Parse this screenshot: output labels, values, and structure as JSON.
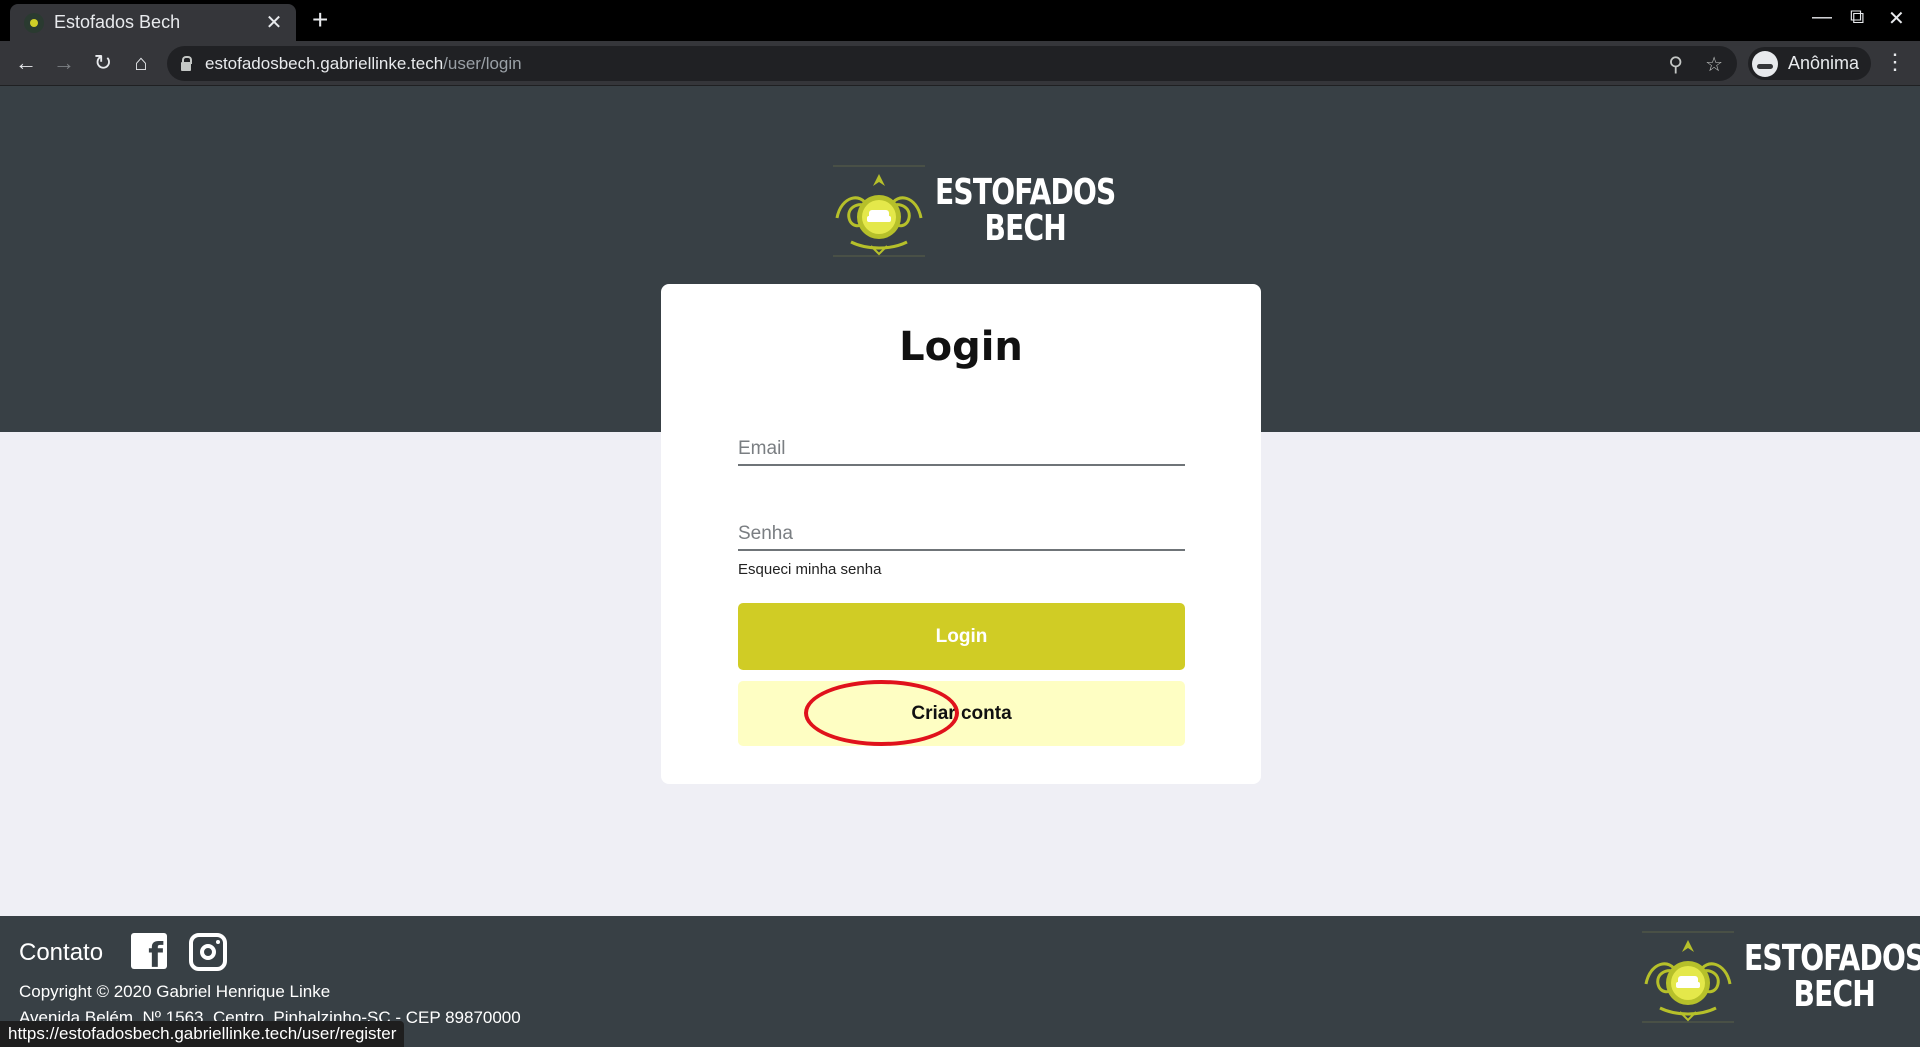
{
  "browser": {
    "tab_title": "Estofados Bech",
    "tab_close": "✕",
    "new_tab": "+",
    "url_host": "estofadosbech.gabriellinke.tech",
    "url_path": "/user/login",
    "profile_label": "Anônima",
    "status_url": "https://estofadosbech.gabriellinke.tech/user/register"
  },
  "brand": {
    "line1": "ESTOFADOS",
    "line2": "BECH",
    "accent_color": "#d0cc25"
  },
  "login": {
    "title": "Login",
    "email_placeholder": "Email",
    "password_placeholder": "Senha",
    "forgot_label": "Esqueci minha senha",
    "submit_label": "Login",
    "register_label": "Criar conta"
  },
  "footer": {
    "contact_label": "Contato",
    "copyright": "Copyright © 2020 Gabriel Henrique Linke",
    "address": "Avenida Belém, Nº 1563, Centro, Pinhalzinho-SC - CEP 89870000"
  },
  "colors": {
    "hero_bg": "#384045",
    "page_bg": "#efeff5",
    "primary_button": "#d0cc25",
    "secondary_button": "#fefec3",
    "annotation_ring": "#e0121c"
  }
}
